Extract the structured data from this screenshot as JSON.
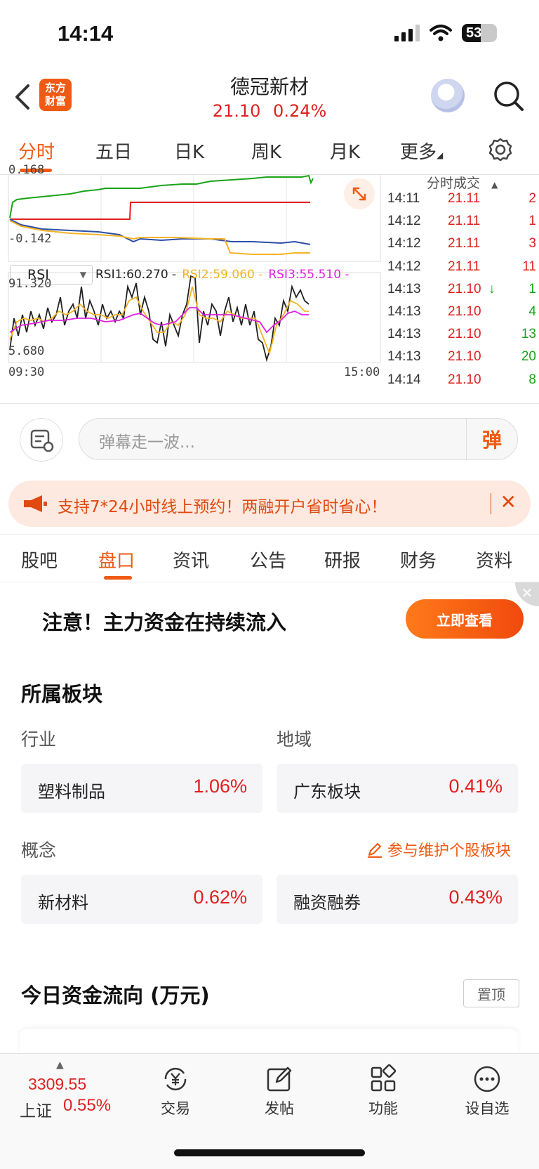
{
  "status": {
    "time": "14:14",
    "battery": "53"
  },
  "header": {
    "logo_line1": "东方",
    "logo_line2": "财富",
    "title": "德冠新材",
    "price": "21.10",
    "change_pct": "0.24%"
  },
  "period_tabs": [
    "分时",
    "五日",
    "日K",
    "周K",
    "月K",
    "更多"
  ],
  "chart": {
    "top_value": "0.168",
    "bottom_value": "-0.142",
    "rsi_select": "RSI",
    "rsi1": "RSI1:60.270 -",
    "rsi2": "RSI2:59.060 -",
    "rsi3": "RSI3:55.510 -",
    "rsi_top": "91.320",
    "rsi_bottom": "5.680",
    "time_start": "09:30",
    "time_end": "15:00",
    "colors": {
      "green": "#1aa31a",
      "red": "#e02020",
      "blue": "#2b4ea8",
      "orange": "#f5b325",
      "magenta": "#e020e0"
    }
  },
  "trades": {
    "title": "分时成交",
    "rows": [
      {
        "time": "14:11",
        "price": "21.11",
        "vol": "2",
        "vol_color": "red"
      },
      {
        "time": "14:12",
        "price": "21.11",
        "vol": "1",
        "vol_color": "red"
      },
      {
        "time": "14:12",
        "price": "21.11",
        "vol": "3",
        "vol_color": "red"
      },
      {
        "time": "14:12",
        "price": "21.11",
        "vol": "11",
        "vol_color": "red"
      },
      {
        "time": "14:13",
        "price": "21.10",
        "vol": "1",
        "vol_color": "green",
        "arrow": "↓"
      },
      {
        "time": "14:13",
        "price": "21.10",
        "vol": "4",
        "vol_color": "green"
      },
      {
        "time": "14:13",
        "price": "21.10",
        "vol": "13",
        "vol_color": "green"
      },
      {
        "time": "14:13",
        "price": "21.10",
        "vol": "20",
        "vol_color": "green"
      },
      {
        "time": "14:14",
        "price": "21.10",
        "vol": "8",
        "vol_color": "green"
      }
    ]
  },
  "danmu": {
    "placeholder": "弹幕走一波...",
    "send_label": "弹"
  },
  "banner": {
    "text": "支持7*24小时线上预约！两融开户省时省心！",
    "close": "✕"
  },
  "sub_tabs": [
    "股吧",
    "盘口",
    "资讯",
    "公告",
    "研报",
    "财务",
    "资料"
  ],
  "ad": {
    "text": "注意！主力资金在持续流入",
    "button": "立即查看"
  },
  "sectors": {
    "title": "所属板块",
    "industry_label": "行业",
    "region_label": "地域",
    "concept_label": "概念",
    "maintain_link": "参与维护个股板块",
    "industry": {
      "name": "塑料制品",
      "pct": "1.06%"
    },
    "region": {
      "name": "广东板块",
      "pct": "0.41%"
    },
    "concept1": {
      "name": "新材料",
      "pct": "0.62%"
    },
    "concept2": {
      "name": "融资融券",
      "pct": "0.43%"
    }
  },
  "fund_flow": {
    "title": "今日资金流向 (万元)",
    "pin_label": "置顶"
  },
  "bottom_nav": {
    "index_value": "3309.55",
    "index_name": "上证",
    "index_pct": "0.55%",
    "items": [
      "交易",
      "发帖",
      "功能",
      "设自选"
    ]
  }
}
